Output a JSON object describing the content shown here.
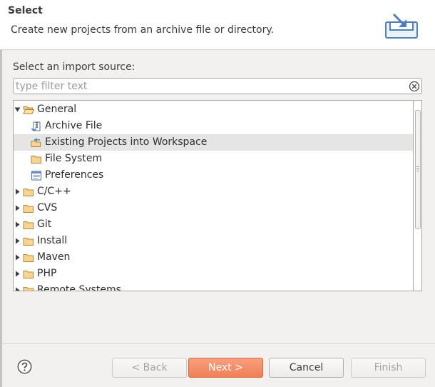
{
  "header": {
    "title": "Select",
    "description": "Create new projects from an archive file or directory.",
    "icon": "import-wizard-icon"
  },
  "source_label": "Select an import source:",
  "filter": {
    "value": "",
    "placeholder": "type filter text",
    "clear_icon": "clear-circle-x-icon"
  },
  "tree": {
    "items": [
      {
        "label": "General",
        "level": 0,
        "expanded": true,
        "icon": "folder-open-icon"
      },
      {
        "label": "Archive File",
        "level": 1,
        "icon": "archive-file-icon"
      },
      {
        "label": "Existing Projects into Workspace",
        "level": 1,
        "icon": "project-folder-icon",
        "selected": true
      },
      {
        "label": "File System",
        "level": 1,
        "icon": "folder-icon"
      },
      {
        "label": "Preferences",
        "level": 1,
        "icon": "preferences-icon"
      },
      {
        "label": "C/C++",
        "level": 0,
        "expanded": false,
        "icon": "folder-icon"
      },
      {
        "label": "CVS",
        "level": 0,
        "expanded": false,
        "icon": "folder-icon"
      },
      {
        "label": "Git",
        "level": 0,
        "expanded": false,
        "icon": "folder-icon"
      },
      {
        "label": "Install",
        "level": 0,
        "expanded": false,
        "icon": "folder-icon"
      },
      {
        "label": "Maven",
        "level": 0,
        "expanded": false,
        "icon": "folder-icon"
      },
      {
        "label": "PHP",
        "level": 0,
        "expanded": false,
        "icon": "folder-icon"
      },
      {
        "label": "Remote Systems",
        "level": 0,
        "expanded": false,
        "icon": "folder-icon"
      }
    ]
  },
  "buttons": {
    "help_icon": "help-question-icon",
    "back": "< Back",
    "next": "Next >",
    "cancel": "Cancel",
    "finish": "Finish"
  },
  "colors": {
    "accent": "#ef7f56",
    "selection": "#e6e5e3",
    "folder": "#e9b96e"
  }
}
